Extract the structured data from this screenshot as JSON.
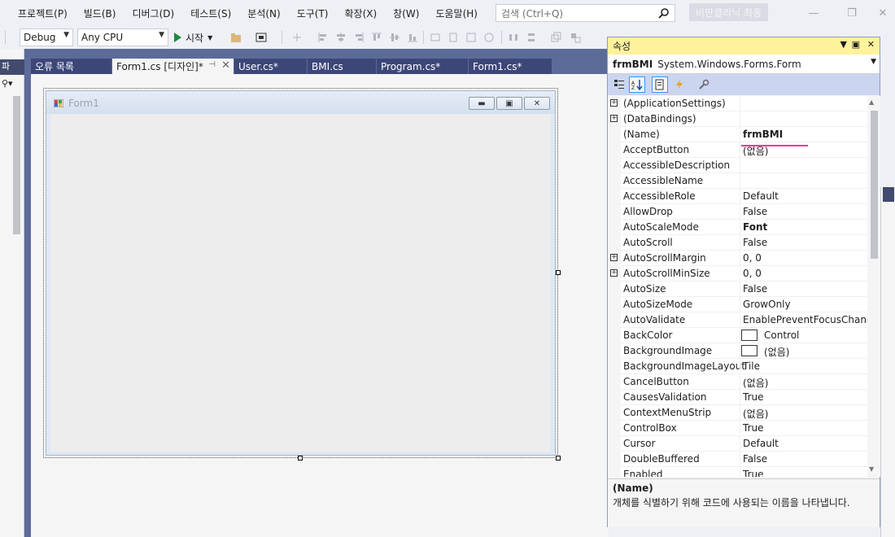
{
  "menu": [
    "프로젝트(P)",
    "빌드(B)",
    "디버그(D)",
    "테스트(S)",
    "분석(N)",
    "도구(T)",
    "확장(X)",
    "창(W)",
    "도움말(H)"
  ],
  "search": {
    "placeholder": "검색 (Ctrl+Q)"
  },
  "solution_name": "비만클리닉 최종",
  "toolbar": {
    "config": "Debug",
    "platform": "Any CPU",
    "start_label": "시작"
  },
  "left_strip_label": "파",
  "tabs": [
    {
      "label": "오류 목록"
    },
    {
      "label": "Form1.cs [디자인]*",
      "active": true
    },
    {
      "label": "User.cs*"
    },
    {
      "label": "BMI.cs"
    },
    {
      "label": "Program.cs*"
    },
    {
      "label": "Form1.cs*"
    }
  ],
  "form": {
    "title": "Form1"
  },
  "properties": {
    "title": "속성",
    "object_name": "frmBMI",
    "object_type": "System.Windows.Forms.Form",
    "rows": [
      {
        "name": "(ApplicationSettings)",
        "value": "",
        "expand": true
      },
      {
        "name": "(DataBindings)",
        "value": "",
        "expand": true
      },
      {
        "name": "(Name)",
        "value": "frmBMI",
        "bold": true
      },
      {
        "name": "AcceptButton",
        "value": "(없음)"
      },
      {
        "name": "AccessibleDescription",
        "value": ""
      },
      {
        "name": "AccessibleName",
        "value": ""
      },
      {
        "name": "AccessibleRole",
        "value": "Default"
      },
      {
        "name": "AllowDrop",
        "value": "False"
      },
      {
        "name": "AutoScaleMode",
        "value": "Font",
        "bold": true
      },
      {
        "name": "AutoScroll",
        "value": "False"
      },
      {
        "name": "AutoScrollMargin",
        "value": "0, 0",
        "expand": true
      },
      {
        "name": "AutoScrollMinSize",
        "value": "0, 0",
        "expand": true
      },
      {
        "name": "AutoSize",
        "value": "False"
      },
      {
        "name": "AutoSizeMode",
        "value": "GrowOnly"
      },
      {
        "name": "AutoValidate",
        "value": "EnablePreventFocusChange"
      },
      {
        "name": "BackColor",
        "value": "Control",
        "swatch": true
      },
      {
        "name": "BackgroundImage",
        "value": "(없음)",
        "swatch": true
      },
      {
        "name": "BackgroundImageLayout",
        "value": "Tile"
      },
      {
        "name": "CancelButton",
        "value": "(없음)"
      },
      {
        "name": "CausesValidation",
        "value": "True"
      },
      {
        "name": "ContextMenuStrip",
        "value": "(없음)"
      },
      {
        "name": "ControlBox",
        "value": "True"
      },
      {
        "name": "Cursor",
        "value": "Default"
      },
      {
        "name": "DoubleBuffered",
        "value": "False"
      },
      {
        "name": "Enabled",
        "value": "True"
      }
    ],
    "description_title": "(Name)",
    "description_text": "개체를 식별하기 위해 코드에 사용되는 이름을 나타냅니다."
  },
  "colors": {
    "accent_yellow": "#fff29d",
    "tab_bg": "#3c4778",
    "doc_bg": "#5d6b99"
  }
}
